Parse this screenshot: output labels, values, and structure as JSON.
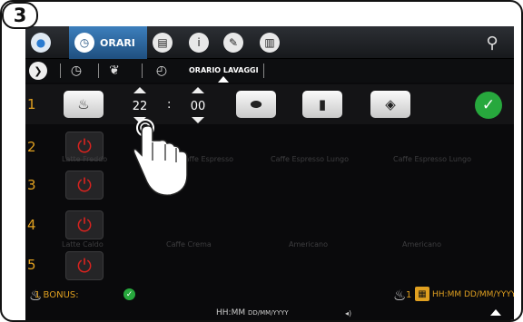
{
  "step_label": "3",
  "topbar": {
    "tab_label": "ORARI"
  },
  "subbar": {
    "label": "ORARIO LAVAGGI"
  },
  "rows": [
    {
      "number": "1"
    },
    {
      "number": "2",
      "ghost_labels": [
        "Latte Freddo",
        "Caffe Espresso",
        "Caffe Espresso Lungo",
        "Caffe Espresso Lungo"
      ]
    },
    {
      "number": "3"
    },
    {
      "number": "4",
      "ghost_labels": [
        "Latte Caldo",
        "Caffe Crema",
        "Americano",
        "Americano"
      ]
    },
    {
      "number": "5"
    }
  ],
  "timer": {
    "hours": "22",
    "separator": ":",
    "minutes": "00"
  },
  "bottom": {
    "bonus_label": "1 BONUS:",
    "right_count": "1",
    "datetime_right": "HH:MM DD/MM/YYYY",
    "datetime_center_time": "HH:MM",
    "datetime_center_date": "DD/MM/YYYY"
  },
  "colors": {
    "accent_orange": "#e0a020",
    "power_red": "#d9231f",
    "confirm_green": "#27a83d",
    "tab_blue": "#3d7fbd"
  },
  "icons": [
    "water-drop-icon",
    "clock-icon",
    "calendar-icon",
    "info-icon",
    "pencil-icon",
    "stats-icon",
    "wrench-icon",
    "chevron-right-icon",
    "leaf-icon",
    "power-icon",
    "milk-cup-icon",
    "coffee-bean-icon",
    "thermometer-bottle-icon",
    "tablet-icon",
    "check-icon",
    "hand-pointer-icon"
  ]
}
